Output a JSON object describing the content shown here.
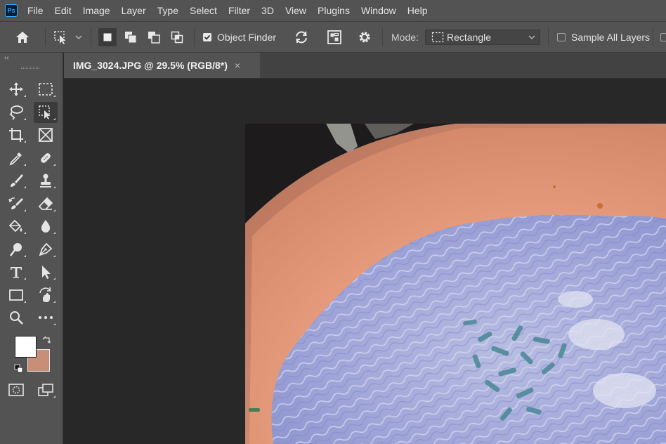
{
  "app": {
    "logo_text": "Ps"
  },
  "menu": [
    "File",
    "Edit",
    "Image",
    "Layer",
    "Type",
    "Select",
    "Filter",
    "3D",
    "View",
    "Plugins",
    "Window",
    "Help"
  ],
  "options_bar": {
    "object_finder_label": "Object Finder",
    "object_finder_checked": true,
    "mode_label": "Mode:",
    "mode_value": "Rectangle",
    "sample_all_layers_label": "Sample All Layers",
    "sample_all_layers_checked": false
  },
  "toolbar": {
    "collapse_glyph": "‹‹",
    "foreground_color": "#ffffff",
    "background_color": "#c98e77",
    "tools": [
      "move-tool",
      "rectangular-marquee-tool",
      "lasso-tool",
      "object-selection-tool",
      "crop-tool",
      "frame-tool",
      "eyedropper-tool",
      "spot-healing-brush-tool",
      "brush-tool",
      "clone-stamp-tool",
      "history-brush-tool",
      "eraser-tool",
      "paint-bucket-tool",
      "blur-tool",
      "dodge-tool",
      "pen-tool",
      "type-tool",
      "path-selection-tool",
      "rectangle-tool",
      "hand-rotate-tool",
      "zoom-tool",
      "more-tools"
    ]
  },
  "document": {
    "tab_title": "IMG_3024.JPG @ 29.5% (RGB/8*)",
    "close_glyph": "×"
  }
}
